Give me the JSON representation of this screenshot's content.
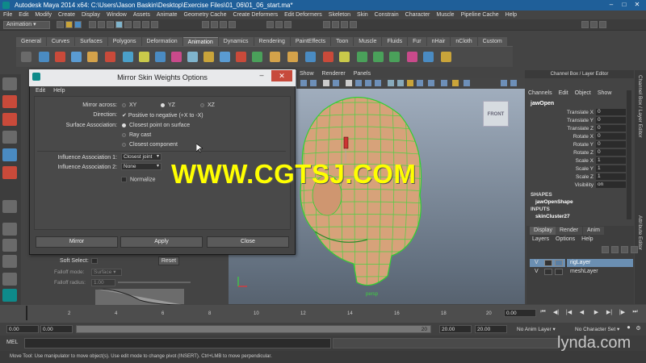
{
  "window": {
    "title": "Autodesk Maya 2014 x64: C:\\Users\\Jason Baskin\\Desktop\\Exercise Files\\01_06\\01_06_start.ma*",
    "minimize": "–",
    "maximize": "□",
    "close": "✕"
  },
  "menubar": [
    "File",
    "Edit",
    "Modify",
    "Create",
    "Display",
    "Window",
    "Assets",
    "Animate",
    "Geometry Cache",
    "Create Deformers",
    "Edit Deformers",
    "Skeleton",
    "Skin",
    "Constrain",
    "Character",
    "Muscle",
    "Pipeline Cache",
    "Help"
  ],
  "status_line": {
    "mode": "Animation"
  },
  "shelf_tabs": [
    "General",
    "Curves",
    "Surfaces",
    "Polygons",
    "Deformation",
    "Animation",
    "Dynamics",
    "Rendering",
    "PaintEffects",
    "Toon",
    "Muscle",
    "Fluids",
    "Fur",
    "nHair",
    "nCloth",
    "Custom"
  ],
  "shelf_active_tab": "Animation",
  "viewport": {
    "menu": [
      "Show",
      "Renderer",
      "Panels"
    ],
    "view_cube": "FRONT",
    "overlay_text": "persp"
  },
  "channel_box": {
    "title": "Channel Box / Layer Editor",
    "menu": [
      "Channels",
      "Edit",
      "Object",
      "Show"
    ],
    "object": "jawOpen",
    "attributes": [
      {
        "name": "Translate X",
        "value": "0"
      },
      {
        "name": "Translate Y",
        "value": "0"
      },
      {
        "name": "Translate Z",
        "value": "0"
      },
      {
        "name": "Rotate X",
        "value": "0"
      },
      {
        "name": "Rotate Y",
        "value": "0"
      },
      {
        "name": "Rotate Z",
        "value": "0"
      },
      {
        "name": "Scale X",
        "value": "1"
      },
      {
        "name": "Scale Y",
        "value": "1"
      },
      {
        "name": "Scale Z",
        "value": "1"
      },
      {
        "name": "Visibility",
        "value": "on"
      }
    ],
    "shapes_header": "SHAPES",
    "shape": "jawOpenShape",
    "inputs_header": "INPUTS",
    "input": "skinCluster27"
  },
  "side_tabs": [
    "Channel Box / Layer Editor",
    "Attribute Editor"
  ],
  "layer_editor": {
    "tabs": [
      "Display",
      "Render",
      "Anim"
    ],
    "menu": [
      "Layers",
      "Options",
      "Help"
    ],
    "layers": [
      {
        "v": "V",
        "name": "rigLayer",
        "selected": true
      },
      {
        "v": "V",
        "name": "meshLayer",
        "selected": false
      }
    ]
  },
  "dialog": {
    "title": "Mirror Skin Weights Options",
    "menu": [
      "Edit",
      "Help"
    ],
    "mirror_across": {
      "label": "Mirror across:",
      "options": [
        "XY",
        "YZ",
        "XZ"
      ],
      "selected": "YZ"
    },
    "direction": {
      "label": "Direction:",
      "option": "Positive to negative (+X to -X)",
      "checked": true
    },
    "surface_association": {
      "label": "Surface Association:",
      "options": [
        "Closest point on surface",
        "Ray cast",
        "Closest component"
      ],
      "selected": "Closest point on surface"
    },
    "influence_1": {
      "label": "Influence Association 1:",
      "value": "Closest joint"
    },
    "influence_2": {
      "label": "Influence Association 2:",
      "value": "None"
    },
    "normalize": {
      "label": "Normalize",
      "checked": false
    },
    "buttons": {
      "mirror": "Mirror",
      "apply": "Apply",
      "close": "Close"
    }
  },
  "tool_settings": {
    "soft_select_label": "Soft Select:",
    "reset": "Reset",
    "falloff_mode_label": "Falloff mode:",
    "falloff_mode_value": "Surface",
    "falloff_radius_label": "Falloff radius:",
    "falloff_radius_value": "1.00"
  },
  "timeline": {
    "ticks": [
      "2",
      "4",
      "6",
      "8",
      "10",
      "12",
      "14",
      "16",
      "18",
      "20"
    ],
    "current_frame": "0.00"
  },
  "range": {
    "start": "0.00",
    "playback_start": "0.00",
    "playback_end": "20",
    "end_a": "20.00",
    "end_b": "20.00",
    "anim_layer": "No Anim Layer",
    "character": "No Character Set"
  },
  "mel_label": "MEL",
  "status_bar": "Move Tool: Use manipulator to move object(s). Use edit mode to change pivot (INSERT). Ctrl+LMB to move perpendicular.",
  "watermark": "WWW.CGTSJ.COM",
  "brand": "lynda.com"
}
